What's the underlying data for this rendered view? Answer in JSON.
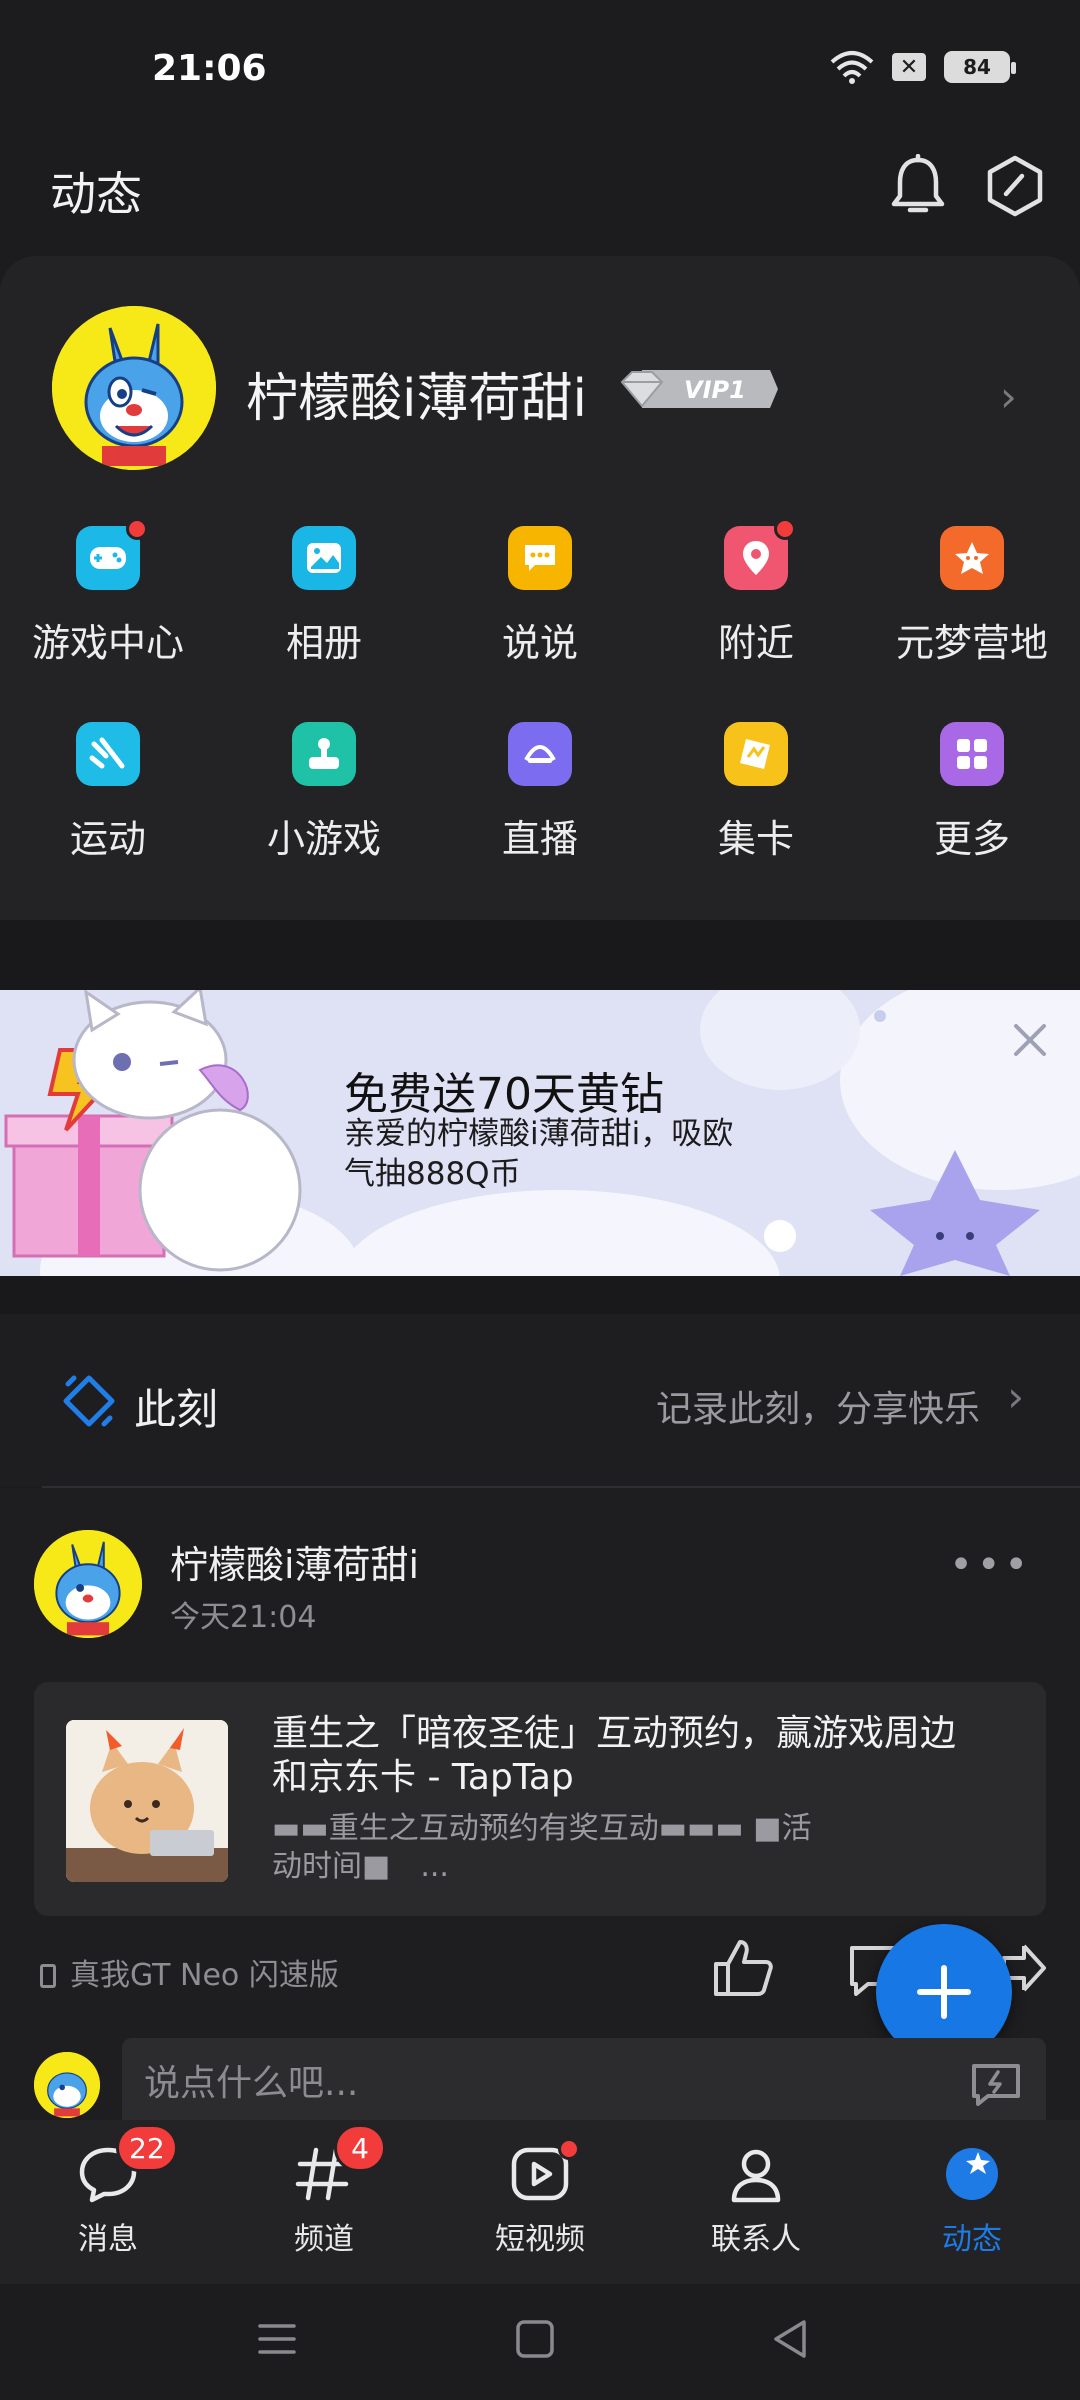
{
  "status_bar": {
    "time": "21:06",
    "battery": "84",
    "sim_icon": "sim-x-icon",
    "wifi_icon": "wifi-icon"
  },
  "header": {
    "title": "动态",
    "icons": [
      "bell-icon",
      "hexagon-settings-icon"
    ]
  },
  "profile": {
    "name": "柠檬酸i薄荷甜i",
    "vip": "VIP1"
  },
  "grid": [
    {
      "label": "游戏中心",
      "icon": "gamepad-icon",
      "color": "#1cb8e8",
      "dot": true
    },
    {
      "label": "相册",
      "icon": "album-icon",
      "color": "#19b6e6",
      "dot": false
    },
    {
      "label": "说说",
      "icon": "chat-bubble-icon",
      "color": "#f7b500",
      "dot": false
    },
    {
      "label": "附近",
      "icon": "location-pin-icon",
      "color": "#f05670",
      "dot": true
    },
    {
      "label": "元梦营地",
      "icon": "star-face-icon",
      "color": "#f46a2a",
      "dot": false
    },
    {
      "label": "运动",
      "icon": "run-icon",
      "color": "#1fbce8",
      "dot": false
    },
    {
      "label": "小游戏",
      "icon": "joystick-icon",
      "color": "#1fc2a6",
      "dot": false
    },
    {
      "label": "直播",
      "icon": "live-icon",
      "color": "#7b6cf0",
      "dot": false
    },
    {
      "label": "集卡",
      "icon": "card-icon",
      "color": "#f7c21a",
      "dot": false
    },
    {
      "label": "更多",
      "icon": "more-grid-icon",
      "color": "#a968e6",
      "dot": false
    }
  ],
  "banner": {
    "title": "免费送70天黄钻",
    "subtitle": "亲爱的柠檬酸i薄荷甜i，吸欧气抽888Q币"
  },
  "moments": {
    "title": "此刻",
    "record": "记录此刻，分享快乐"
  },
  "post": {
    "author": "柠檬酸i薄荷甜i",
    "time": "今天21:04",
    "more": "•••",
    "share_title": "重生之「暗夜圣徒」互动预约，赢游戏周边和京东卡 - TapTap",
    "share_desc": "▬▬重生之互动预约有奖互动▬▬▬ ■活动时间■　...",
    "device": "真我GT Neo 闪速版",
    "comment_placeholder": "说点什么吧..."
  },
  "tabs": [
    {
      "label": "消息",
      "badge": "22"
    },
    {
      "label": "频道",
      "badge": "4"
    },
    {
      "label": "短视频",
      "badge": ""
    },
    {
      "label": "联系人",
      "badge": ""
    },
    {
      "label": "动态",
      "badge": ""
    }
  ],
  "colors": {
    "accent": "#1677e5",
    "badge": "#f23c3c",
    "background": "#1c1c1e"
  }
}
